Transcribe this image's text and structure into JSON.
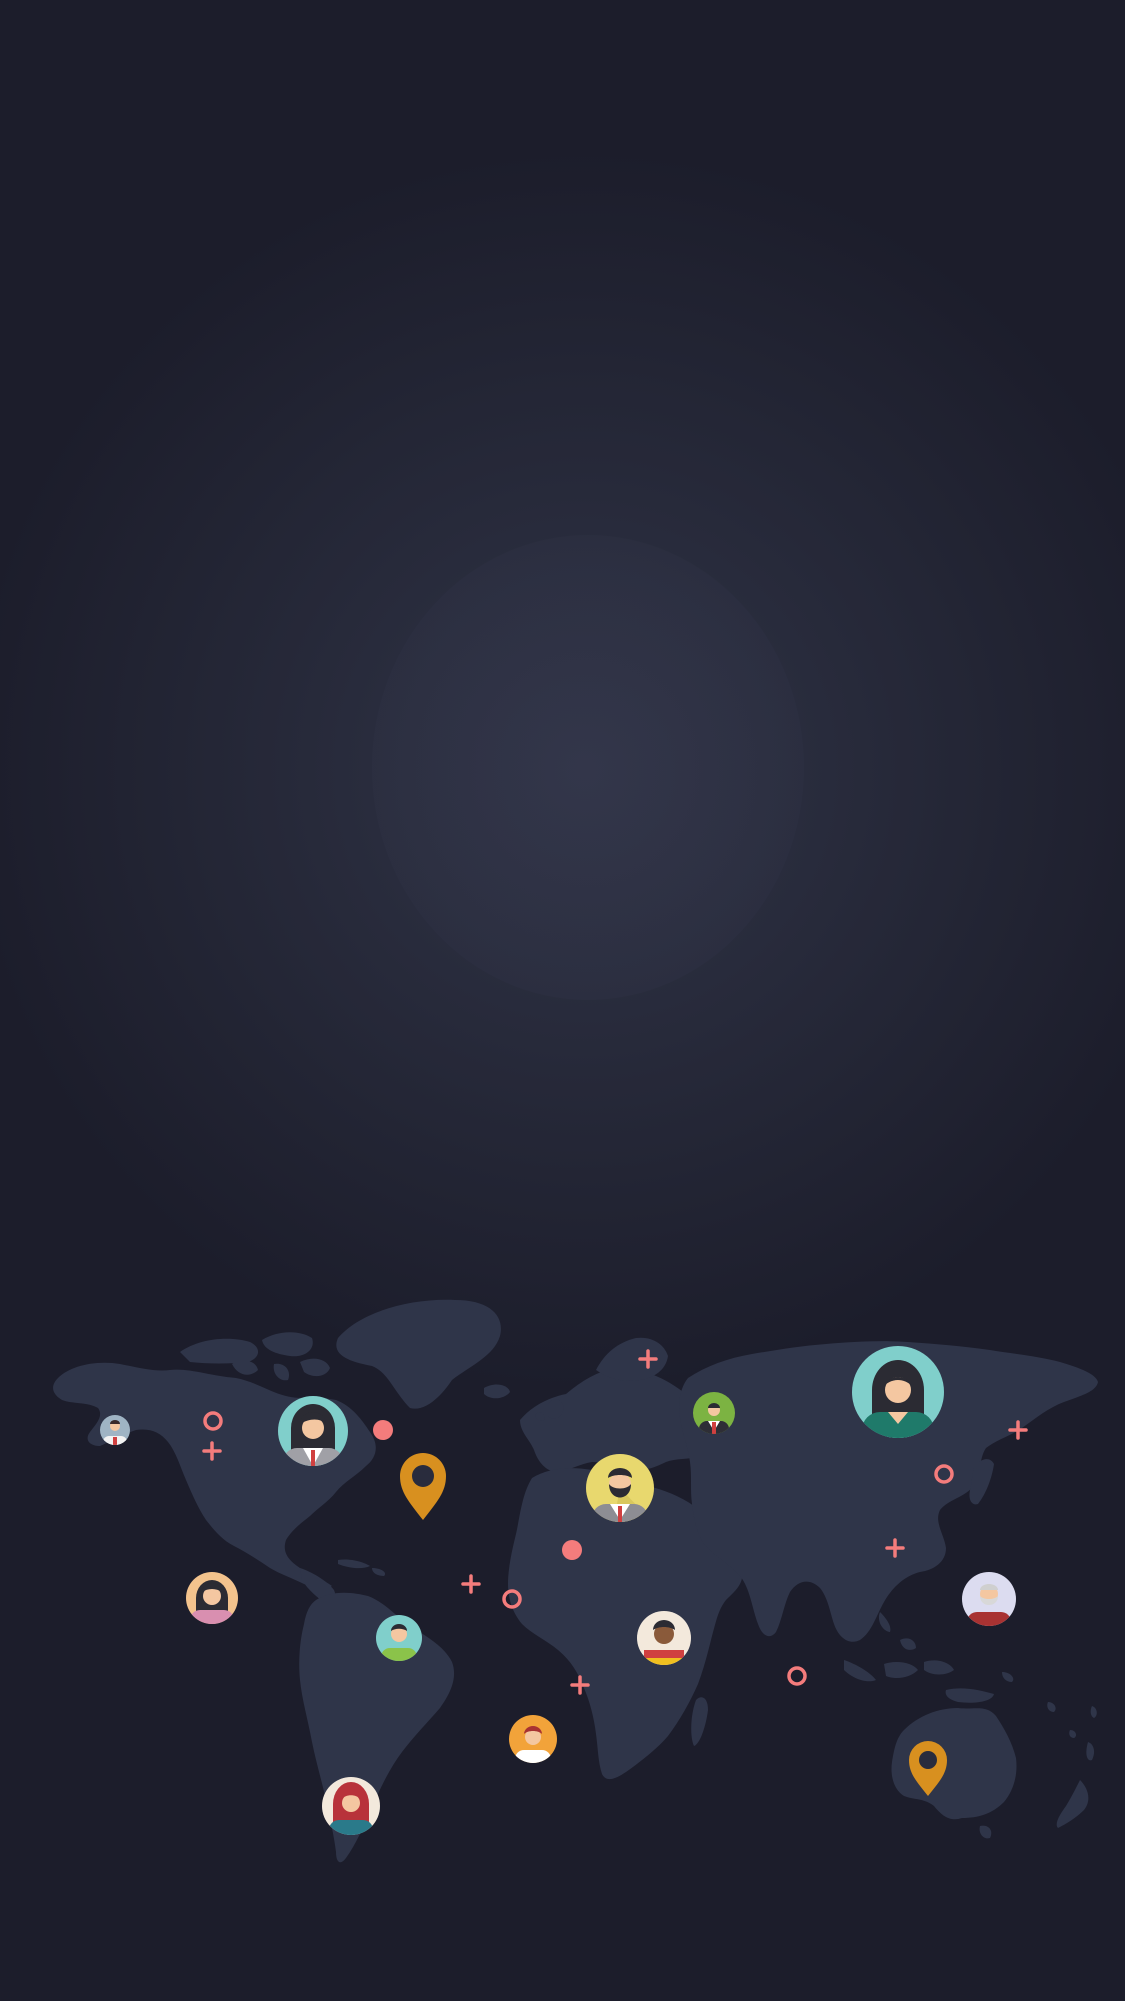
{
  "colors": {
    "land": "#2f3549",
    "accent": "#f47c7c",
    "pin": "#d8901f",
    "teal": "#80cfcb",
    "yellow": "#e8d86e",
    "green": "#7cb342",
    "orange": "#f2a33a",
    "peach": "#f3c38d",
    "cream": "#f3e9dc",
    "lavender": "#dcdcf0"
  },
  "icons": {
    "pin": "location-pin-icon",
    "avatar": "person-avatar-icon",
    "plus": "plus-sign-icon",
    "ring": "ring-icon",
    "dot": "dot-icon"
  }
}
